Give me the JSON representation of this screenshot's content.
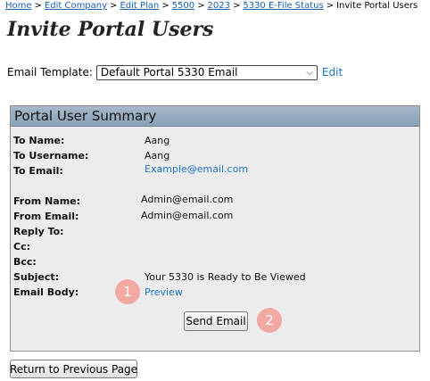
{
  "breadcrumb": {
    "items": [
      "Home",
      "Edit Company",
      "Edit Plan",
      "5500",
      "2023",
      "5330 E-File Status"
    ],
    "current": "Invite Portal Users",
    "separator": ">"
  },
  "page_title": "Invite Portal Users",
  "template": {
    "label": "Email Template:",
    "selected": "Default Portal 5330 Email",
    "edit_label": "Edit"
  },
  "summary": {
    "header": "Portal User Summary",
    "to_name_label": "To Name:",
    "to_name": "Aang",
    "to_username_label": "To Username:",
    "to_username": "Aang",
    "to_email_label": "To Email:",
    "to_email": "Example@email.com",
    "from_name_label": "From Name:",
    "from_name": "Admin@email.com",
    "from_email_label": "From Email:",
    "from_email": "Admin@email.com",
    "reply_to_label": "Reply To:",
    "cc_label": "Cc:",
    "bcc_label": "Bcc:",
    "subject_label": "Subject:",
    "subject": "Your 5330 is Ready to Be Viewed",
    "body_label": "Email Body:",
    "preview_label": "Preview",
    "send_label": "Send Email"
  },
  "annotations": {
    "one": "1",
    "two": "2"
  },
  "return_label": "Return to Previous Page",
  "colors": {
    "link": "#1a73c8",
    "badge": "#f2a9a1",
    "panel_header": "#8aa2b7"
  }
}
